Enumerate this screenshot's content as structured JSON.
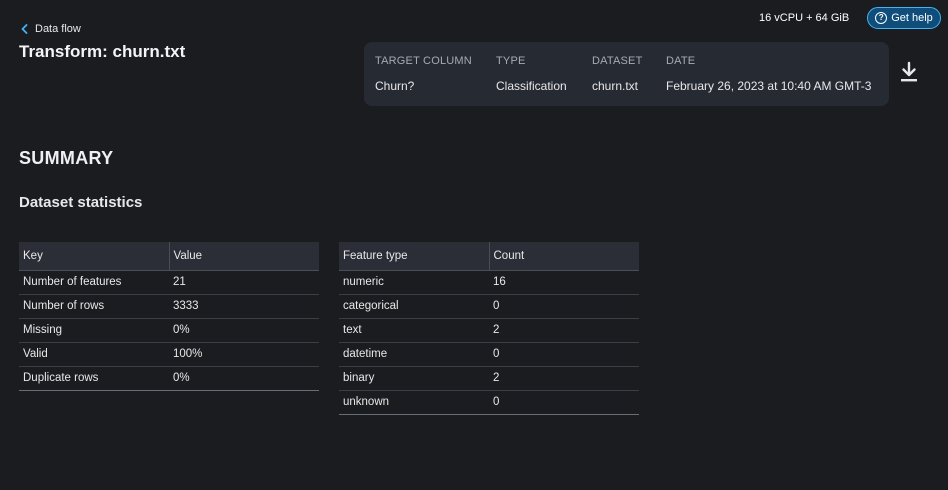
{
  "header": {
    "back_label": "Data flow",
    "title": "Transform: churn.txt",
    "resources": "16 vCPU + 64 GiB",
    "help_label": "Get help"
  },
  "meta": {
    "target_column": {
      "label": "TARGET COLUMN",
      "value": "Churn?"
    },
    "type": {
      "label": "TYPE",
      "value": "Classification"
    },
    "dataset": {
      "label": "DATASET",
      "value": "churn.txt"
    },
    "date": {
      "label": "DATE",
      "value": "February 26, 2023 at 10:40 AM GMT-3"
    }
  },
  "summary": {
    "title": "SUMMARY",
    "subtitle": "Dataset statistics"
  },
  "key_table": {
    "headers": [
      "Key",
      "Value"
    ],
    "rows": [
      [
        "Number of features",
        "21"
      ],
      [
        "Number of rows",
        "3333"
      ],
      [
        "Missing",
        "0%"
      ],
      [
        "Valid",
        "100%"
      ],
      [
        "Duplicate rows",
        "0%"
      ]
    ]
  },
  "feature_table": {
    "headers": [
      "Feature type",
      "Count"
    ],
    "rows": [
      [
        "numeric",
        "16"
      ],
      [
        "categorical",
        "0"
      ],
      [
        "text",
        "2"
      ],
      [
        "datetime",
        "0"
      ],
      [
        "binary",
        "2"
      ],
      [
        "unknown",
        "0"
      ]
    ]
  },
  "icons": {
    "back": "chevron-left-icon",
    "help": "question-circle-icon",
    "download": "download-icon"
  },
  "colors": {
    "background": "#1b1c20",
    "card": "#262a33",
    "accent": "#42b4f5"
  }
}
